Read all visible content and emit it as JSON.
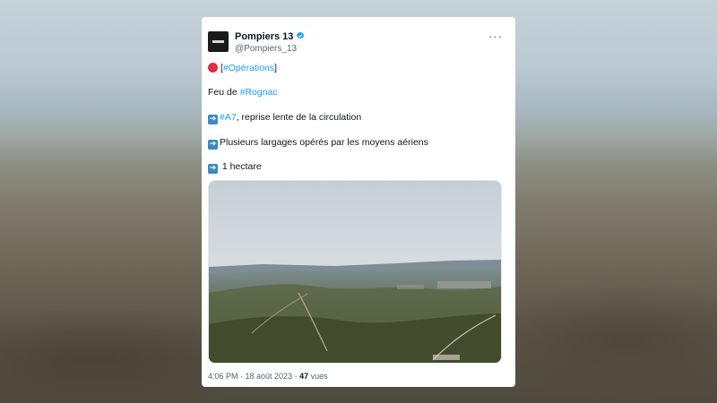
{
  "tweet": {
    "author_name": "Pompiers 13",
    "author_handle": "@Pompiers_13",
    "more_label": "···",
    "line1": {
      "prefix": "[",
      "hashtag": "#Opérations",
      "suffix": "]"
    },
    "line2": {
      "text": "Feu de ",
      "hashtag": "#Rognac"
    },
    "line3": {
      "hashtag": "#A7",
      "text": ", reprise lente de la circulation"
    },
    "line4": {
      "text": "Plusieurs largages opérés par les moyens aériens"
    },
    "line5": {
      "text": " 1 hectare"
    },
    "timestamp": "4:06 PM · 18 août 2023 · ",
    "views_count": "47",
    "views_label": " vues"
  },
  "icons": {
    "status_dot": "red-circle-icon",
    "bullets": "right-arrow-icon",
    "verified": "verified-badge-icon"
  },
  "colors": {
    "link": "#1d9bf0",
    "red_circle": "#dd2e44",
    "arrow_box": "#3b88c3",
    "verified": "#1d9bf0"
  }
}
